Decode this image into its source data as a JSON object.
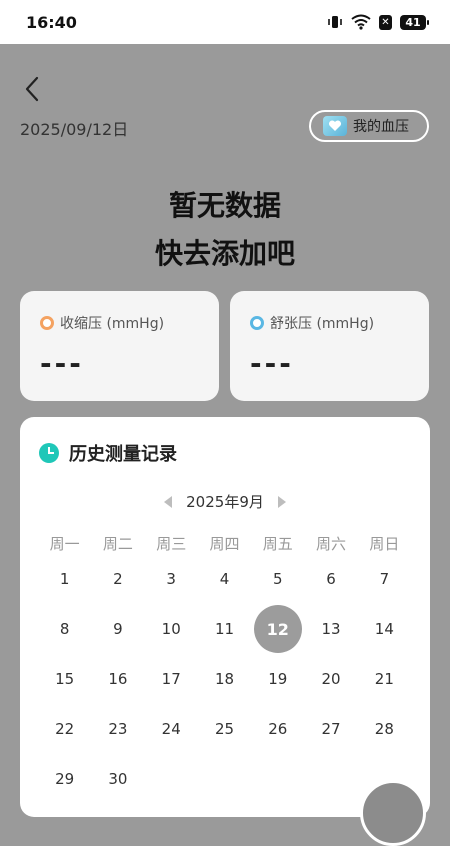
{
  "status_bar": {
    "time": "16:40",
    "battery": "41"
  },
  "header": {
    "date": "2025/09/12日",
    "my_bp_label": "我的血压"
  },
  "empty_state": {
    "line1": "暂无数据",
    "line2": "快去添加吧"
  },
  "systolic": {
    "label": "收缩压 (mmHg)",
    "value": "---"
  },
  "diastolic": {
    "label": "舒张压 (mmHg)",
    "value": "---"
  },
  "history": {
    "title": "历史测量记录",
    "month": "2025年9月",
    "weekdays": [
      "周一",
      "周二",
      "周三",
      "周四",
      "周五",
      "周六",
      "周日"
    ],
    "days": [
      "1",
      "2",
      "3",
      "4",
      "5",
      "6",
      "7",
      "8",
      "9",
      "10",
      "11",
      "12",
      "13",
      "14",
      "15",
      "16",
      "17",
      "18",
      "19",
      "20",
      "21",
      "22",
      "23",
      "24",
      "25",
      "26",
      "27",
      "28",
      "29",
      "30"
    ],
    "selected_day": "12"
  },
  "colors": {
    "selected_day_bg": "#9c9c9c",
    "systolic_ring": "#f4a261",
    "diastolic_ring": "#5ab7e3",
    "history_icon": "#1fc7b8"
  },
  "icons": [
    "back-arrow-icon",
    "blood-pressure-icon",
    "clock-icon",
    "prev-month-icon",
    "next-month-icon",
    "wifi-icon",
    "vibrate-icon",
    "battery-icon"
  ]
}
